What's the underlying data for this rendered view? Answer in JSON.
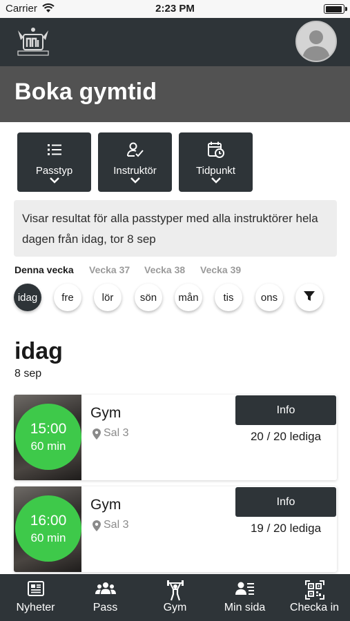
{
  "status_bar": {
    "carrier": "Carrier",
    "time": "2:23 PM",
    "battery_level": 0.95
  },
  "header": {
    "logo_icon": "gym-logo-icon",
    "avatar_icon": "user-avatar-icon"
  },
  "page": {
    "title": "Boka gymtid"
  },
  "filters": [
    {
      "label": "Passtyp",
      "icon": "list-icon"
    },
    {
      "label": "Instruktör",
      "icon": "user-check-icon"
    },
    {
      "label": "Tidpunkt",
      "icon": "calendar-clock-icon"
    }
  ],
  "info_text": "Visar resultat för alla passtyper med alla instruktörer hela dagen från idag, tor 8 sep",
  "weeks": [
    "Denna vecka",
    "Vecka 37",
    "Vecka 38",
    "Vecka 39"
  ],
  "active_week": "Denna vecka",
  "days": [
    "idag",
    "fre",
    "lör",
    "sön",
    "mån",
    "tis",
    "ons"
  ],
  "active_day": "idag",
  "filter_icon": "funnel-icon",
  "day_section": {
    "heading": "idag",
    "date": "8 sep"
  },
  "sessions": [
    {
      "time": "15:00",
      "duration": "60 min",
      "name": "Gym",
      "room": "Sal 3",
      "button": "Info",
      "spots": "20 / 20 lediga"
    },
    {
      "time": "16:00",
      "duration": "60 min",
      "name": "Gym",
      "room": "Sal 3",
      "button": "Info",
      "spots": "19 / 20 lediga"
    }
  ],
  "tabs": [
    {
      "label": "Nyheter",
      "icon": "news-icon"
    },
    {
      "label": "Pass",
      "icon": "group-icon"
    },
    {
      "label": "Gym",
      "icon": "weightlifter-icon"
    },
    {
      "label": "Min sida",
      "icon": "profile-list-icon"
    },
    {
      "label": "Checka in",
      "icon": "qr-code-icon"
    }
  ],
  "colors": {
    "dark": "#2e3438",
    "banner": "#525252",
    "green": "#3ec94a",
    "info_bg": "#ededed"
  }
}
